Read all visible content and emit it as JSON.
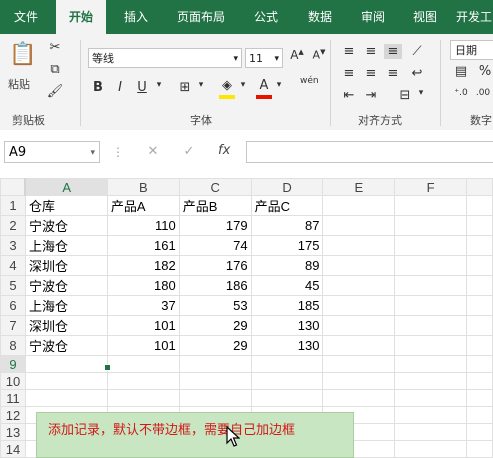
{
  "ribbon": {
    "tabs": [
      "文件",
      "开始",
      "插入",
      "页面布局",
      "公式",
      "数据",
      "审阅",
      "视图",
      "开发工"
    ],
    "active_tab": "开始",
    "clipboard": {
      "paste_label": "粘贴",
      "group_label": "剪贴板"
    },
    "font": {
      "name": "等线",
      "size": "11",
      "group_label": "字体",
      "bold": "B",
      "italic": "I",
      "underline": "U",
      "font_color": "#e51400",
      "fill_color": "#ffe600",
      "wen": "wén"
    },
    "alignment": {
      "group_label": "对齐方式"
    },
    "number": {
      "format": "日期",
      "group_label": "数字"
    }
  },
  "formula_bar": {
    "name_box": "A9",
    "fx": "fx",
    "cancel": "✕",
    "confirm": "✓"
  },
  "sheet": {
    "columns": [
      "A",
      "B",
      "C",
      "D",
      "E",
      "F"
    ],
    "rows": [
      [
        "仓库",
        "产品A",
        "产品B",
        "产品C"
      ],
      [
        "宁波仓",
        "110",
        "179",
        "87"
      ],
      [
        "上海仓",
        "161",
        "74",
        "175"
      ],
      [
        "深圳仓",
        "182",
        "176",
        "89"
      ],
      [
        "宁波仓",
        "180",
        "186",
        "45"
      ],
      [
        "上海仓",
        "37",
        "53",
        "185"
      ],
      [
        "深圳仓",
        "101",
        "29",
        "130"
      ],
      [
        "宁波仓",
        "101",
        "29",
        "130"
      ]
    ],
    "row_numbers": [
      "1",
      "2",
      "3",
      "4",
      "5",
      "6",
      "7",
      "8",
      "9",
      "10",
      "11",
      "12",
      "13",
      "14"
    ]
  },
  "note": {
    "text": "添加记录，默认不带边框，需要自己加边框"
  },
  "colors": {
    "excel_green": "#217346",
    "note_bg": "#c9e6c2",
    "note_text": "#d01818"
  }
}
